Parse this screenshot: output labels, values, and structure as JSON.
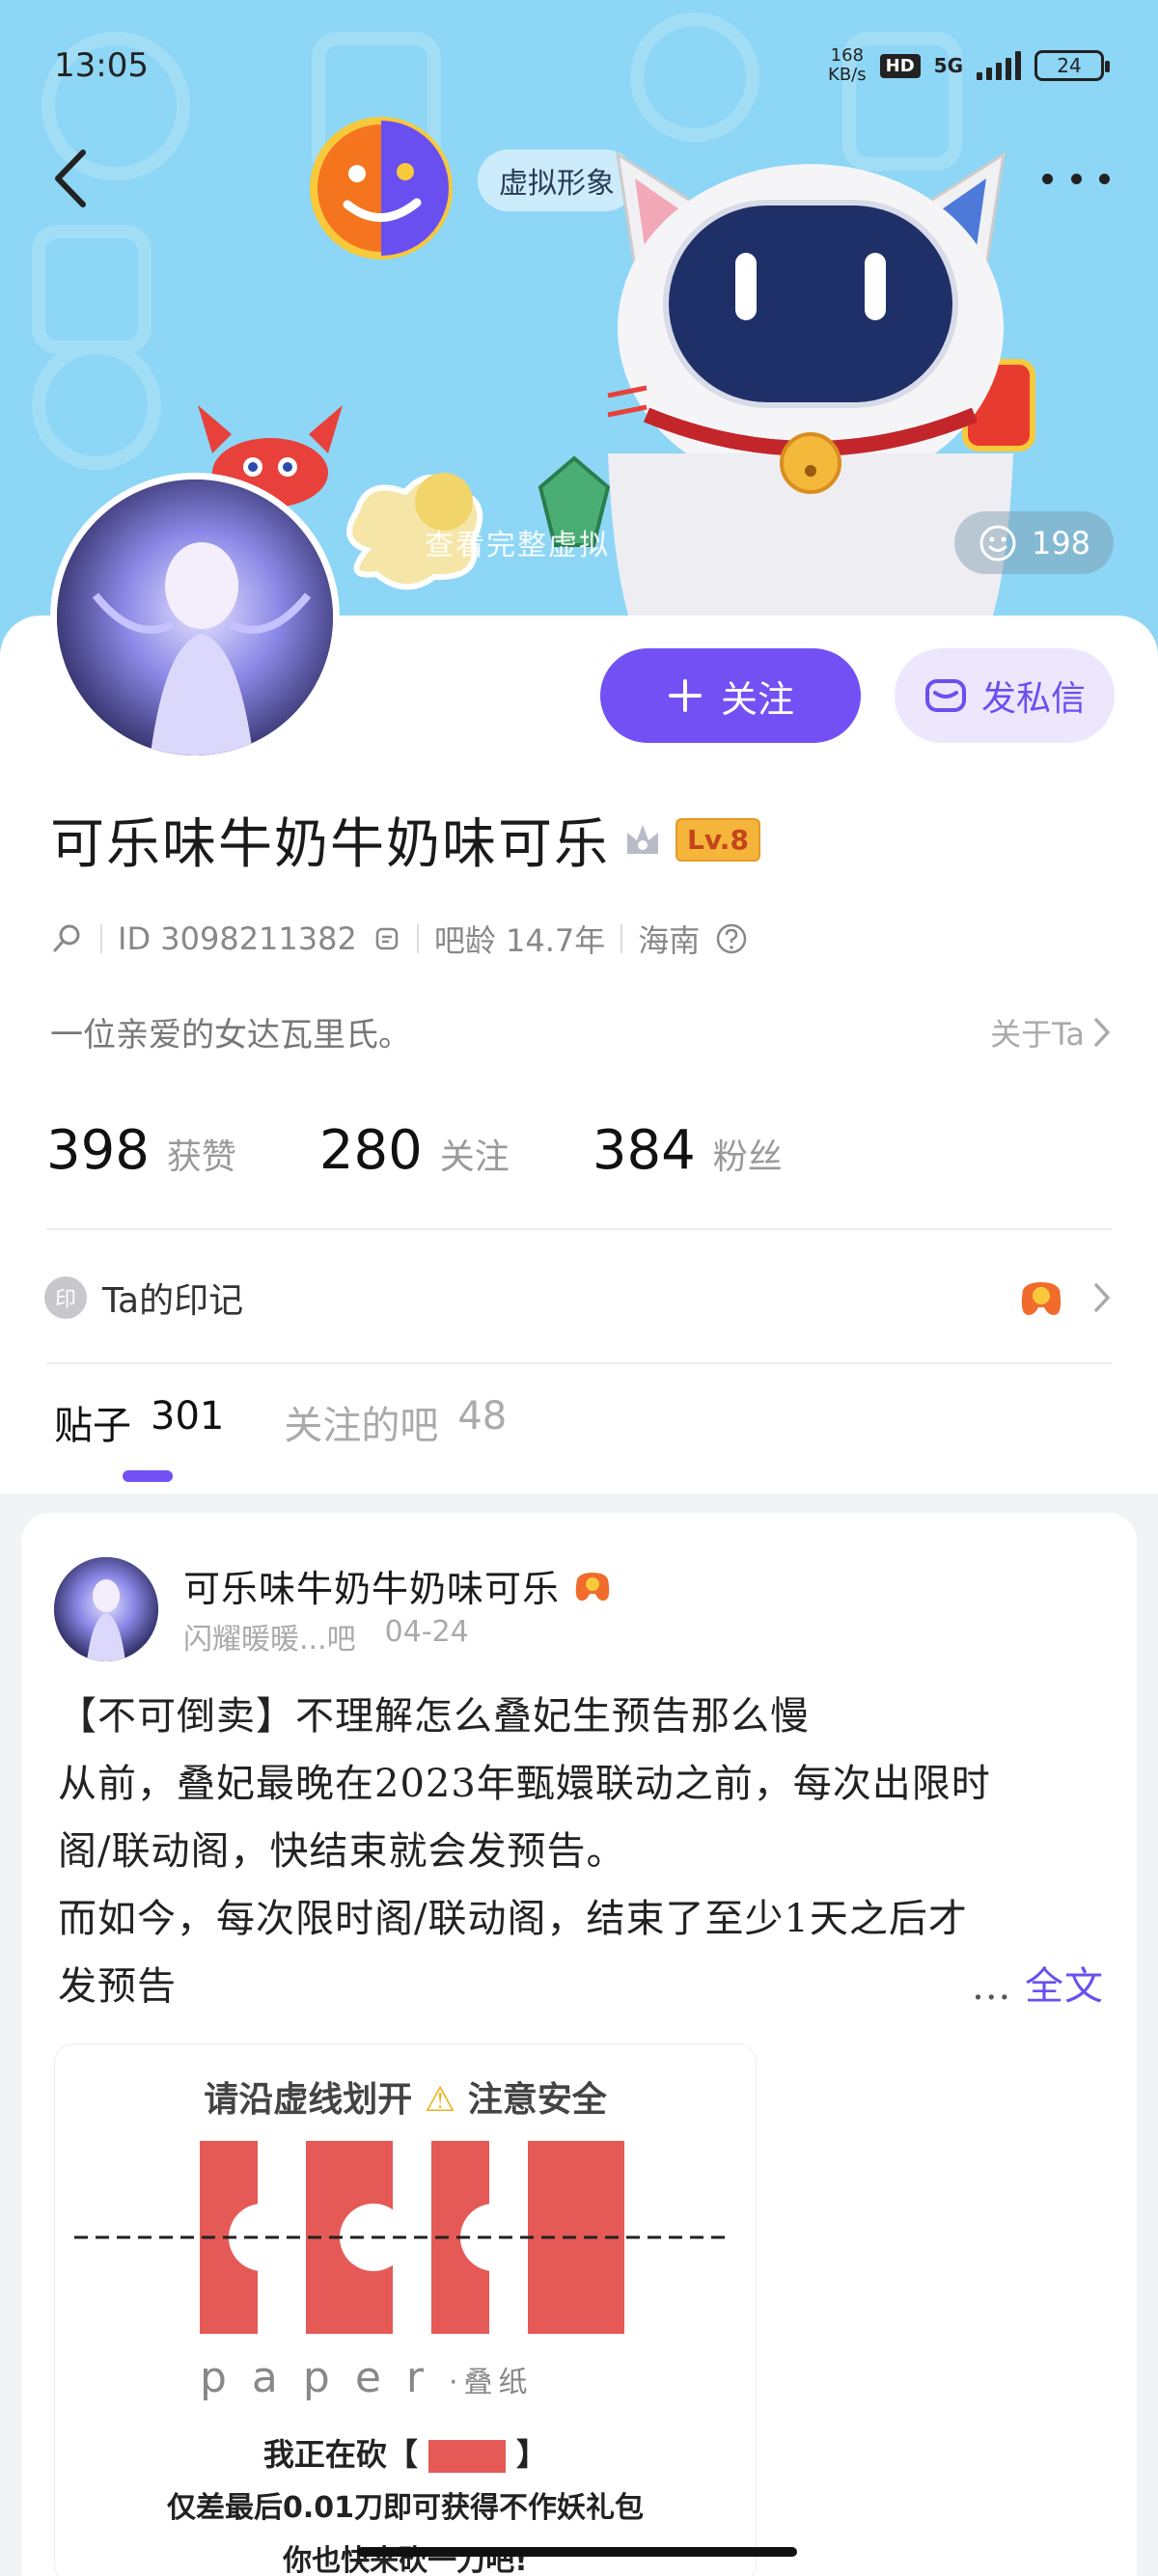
{
  "status_bar": {
    "time": "13:05",
    "net_speed_value": "168",
    "net_speed_unit": "KB/s",
    "hd": "HD",
    "network": "5G",
    "battery": "24"
  },
  "header": {
    "virtual_chip": "虚拟形象",
    "banner_hint": "查看完整虚拟",
    "like_count": "198"
  },
  "profile": {
    "follow_label": "关注",
    "message_label": "发私信",
    "username": "可乐味牛奶牛奶味可乐",
    "level": "Lv.8",
    "id": "ID 3098211382",
    "bar_age": "吧龄 14.7年",
    "location": "海南",
    "bio": "一位亲爱的女达瓦里氏。",
    "about_link": "关于Ta",
    "stats": [
      {
        "num": "398",
        "label": "获赞"
      },
      {
        "num": "280",
        "label": "关注"
      },
      {
        "num": "384",
        "label": "粉丝"
      }
    ],
    "mark_icon": "印",
    "mark_label": "Ta的印记"
  },
  "tabs": [
    {
      "label": "贴子",
      "count": "301"
    },
    {
      "label": "关注的吧",
      "count": "48"
    }
  ],
  "post": {
    "author": "可乐味牛奶牛奶味可乐",
    "forum": "闪耀暖暖...吧",
    "date": "04-24",
    "lines": [
      "【不可倒卖】不理解怎么叠妃生预告那么慢",
      "从前，叠妃最晚在2023年甄嬛联动之前，每次出限时",
      "阁/联动阁，快结束就会发预告。",
      "而如今，每次限时阁/联动阁，结束了至少1天之后才"
    ],
    "last_line": "发预告",
    "ellipsis": "...",
    "full_text": "全文",
    "image": {
      "top_text": "请沿虚线划开",
      "warn_text": "注意安全",
      "brand": "paper",
      "brand_cn": "·叠纸",
      "line1": "我正在砍【",
      "line1_end": "】",
      "line2": "仅差最后0.01刀即可获得不作妖礼包",
      "line3": "你也快来砍一刀吧!"
    }
  },
  "colors": {
    "accent": "#7250f4",
    "banner": "#8ed6f5"
  }
}
